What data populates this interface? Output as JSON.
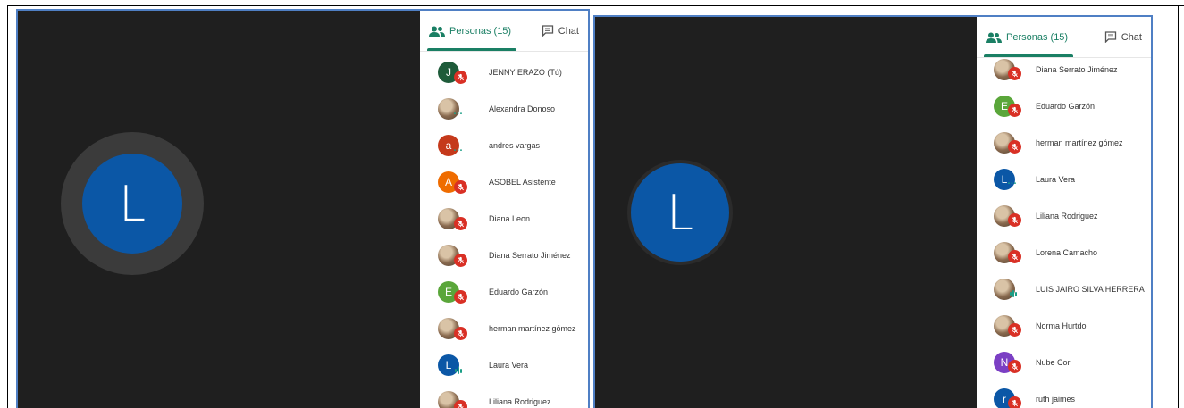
{
  "tabs": {
    "people": "Personas (15)",
    "chat": "Chat"
  },
  "colors": {
    "accent": "#1a7f64",
    "mute_badge": "#d93025",
    "speaking": "#1a9e86",
    "stage_bg": "#1f1f1f"
  },
  "main_avatar_letter": "L",
  "left_participants": [
    {
      "name": "JENNY ERAZO (Tú)",
      "initial": "J",
      "color": "#1e5b3a",
      "status": "muted"
    },
    {
      "name": "Alexandra Donoso",
      "initial": "",
      "color": "",
      "status": "dots"
    },
    {
      "name": "andres vargas",
      "initial": "a",
      "color": "#c5391b",
      "status": "dots"
    },
    {
      "name": "ASOBEL Asistente",
      "initial": "A",
      "color": "#ef6c00",
      "status": "muted"
    },
    {
      "name": "Diana Leon",
      "initial": "",
      "color": "",
      "status": "muted"
    },
    {
      "name": "Diana Serrato Jiménez",
      "initial": "",
      "color": "",
      "status": "muted"
    },
    {
      "name": "Eduardo Garzón",
      "initial": "E",
      "color": "#5aa63a",
      "status": "muted"
    },
    {
      "name": "herman martínez gómez",
      "initial": "",
      "color": "",
      "status": "muted"
    },
    {
      "name": "Laura Vera",
      "initial": "L",
      "color": "#0b57a6",
      "status": "speaking"
    },
    {
      "name": "Liliana Rodriguez",
      "initial": "",
      "color": "",
      "status": "muted"
    }
  ],
  "right_participants": [
    {
      "name": "Diana Serrato Jiménez",
      "initial": "",
      "color": "",
      "status": "muted"
    },
    {
      "name": "Eduardo Garzón",
      "initial": "E",
      "color": "#5aa63a",
      "status": "muted"
    },
    {
      "name": "herman martínez gómez",
      "initial": "",
      "color": "",
      "status": "muted"
    },
    {
      "name": "Laura Vera",
      "initial": "L",
      "color": "#0b57a6",
      "status": "dots"
    },
    {
      "name": "Liliana Rodriguez",
      "initial": "",
      "color": "",
      "status": "muted"
    },
    {
      "name": "Lorena Camacho",
      "initial": "",
      "color": "",
      "status": "muted"
    },
    {
      "name": "LUIS JAIRO SILVA HERRERA",
      "initial": "",
      "color": "",
      "status": "speaking"
    },
    {
      "name": "Norma Hurtdo",
      "initial": "",
      "color": "",
      "status": "muted"
    },
    {
      "name": "Nube Cor",
      "initial": "N",
      "color": "#7b3fc4",
      "status": "muted"
    },
    {
      "name": "ruth jaimes",
      "initial": "r",
      "color": "#0b57a6",
      "status": "muted"
    }
  ]
}
